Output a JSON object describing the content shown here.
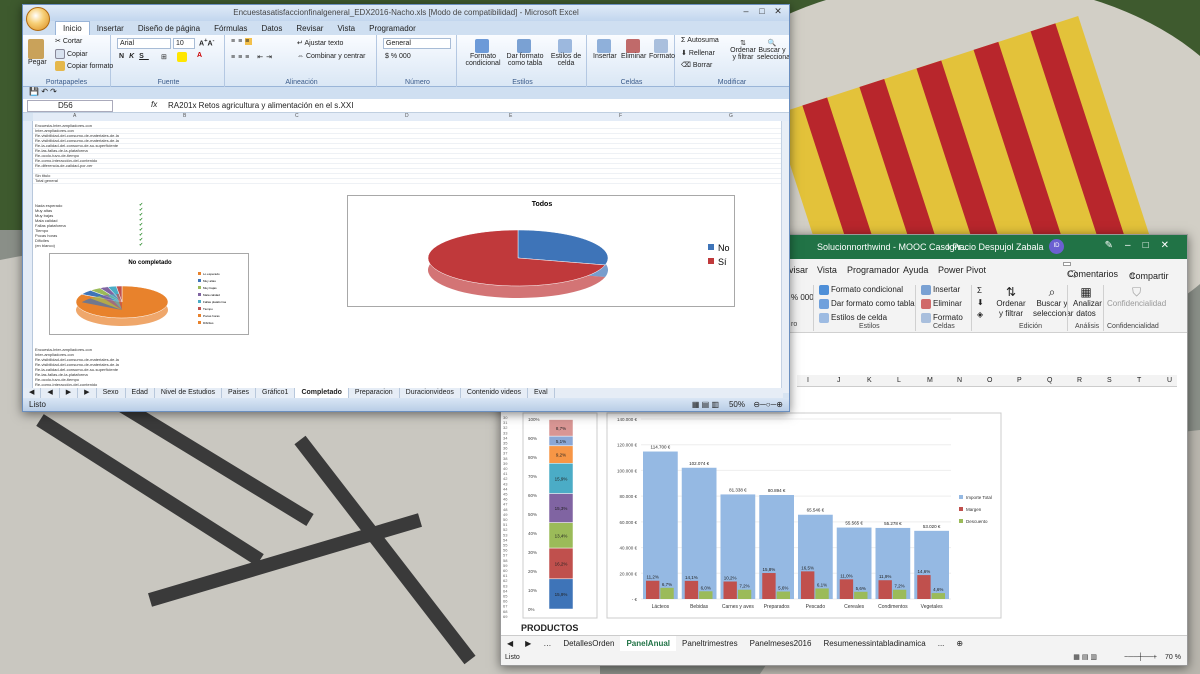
{
  "excel2007": {
    "title": "Encuestasatisfaccionfinalgeneral_EDX2016-Nacho.xls  [Modo de compatibilidad] - Microsoft Excel",
    "tabs": [
      "Inicio",
      "Insertar",
      "Diseño de página",
      "Fórmulas",
      "Datos",
      "Revisar",
      "Vista",
      "Programador"
    ],
    "clipboard": {
      "paste": "Pegar",
      "cut": "Cortar",
      "copy": "Copiar",
      "format_painter": "Copiar formato",
      "label": "Portapapeles"
    },
    "font": {
      "name": "Arial",
      "size": "10",
      "label": "Fuente"
    },
    "alignment": {
      "wrap": "Ajustar texto",
      "merge": "Combinar y centrar",
      "label": "Alineación"
    },
    "number": {
      "format": "General",
      "currency": "%",
      "thousands": "000",
      "label": "Número"
    },
    "styles": {
      "conditional": "Formato condicional",
      "as_table": "Dar formato como tabla",
      "cell_styles": "Estilos de celda",
      "label": "Estilos"
    },
    "cells": {
      "insert": "Insertar",
      "delete": "Eliminar",
      "format": "Formato",
      "label": "Celdas"
    },
    "editing": {
      "autosum": "Autosuma",
      "fill": "Rellenar",
      "clear": "Borrar",
      "sort": "Ordenar y filtrar",
      "find": "Buscar y seleccionar",
      "label": "Modificar"
    },
    "name_box": "D56",
    "formula": "RA201x Retos agricultura y alimentación en el s.XXI",
    "columns": [
      "A",
      "B",
      "C",
      "D",
      "E",
      "F",
      "G",
      "H"
    ],
    "sheet_rows": [
      "Encuesta-Inter-ampliadores-con",
      "Inter-ampliadores-con",
      "Re-visibilidad-del-consumo-de-materiales-de-la",
      "Re-visibilidad-del-consumo-de-materiales-de-la",
      "Re-la-calidad-del-consumo-de-su-superficiente",
      "Re-las-fallas-de-la-plataforma",
      "Re-ocolo-tuvo-de-tiempo",
      "Re-como-interacción-del-contenido",
      "Re-diferencia-de-calidad-por-ver",
      "",
      "Sin titulo",
      "Total general"
    ],
    "rating_rows": [
      "Nada esperado",
      "Muy altas",
      "Muy bajas",
      "Mala calidad",
      "Fallas plataforma",
      "Tiempo",
      "Pocas horas",
      "Difíciles",
      "(en blanco)"
    ],
    "sheet_tabs": [
      "Sexo",
      "Edad",
      "Nivel de Estudios",
      "Paises",
      "Gráfico1",
      "Completado",
      "Preparacion",
      "Duracionvideos",
      "Contenido videos",
      "Eval"
    ],
    "active_tab": "Completado",
    "status": "Listo",
    "zoom": "50%",
    "chart_todos": {
      "title": "Todos",
      "legend": [
        "No",
        "Sí"
      ],
      "slices": [
        {
          "label": "No",
          "value": 29,
          "color": "#3e74b8"
        },
        {
          "label": "Sí",
          "value": 71,
          "color": "#c0393b"
        }
      ]
    },
    "chart_no_completado": {
      "title": "No completado",
      "legend": [
        "Lo esperado",
        "Muy altas",
        "Muy bajas",
        "Mala calidad",
        "Fallas plataforma",
        "Tiempo",
        "Pocas horas",
        "Difíciles"
      ],
      "slices": [
        {
          "value": 83,
          "color": "#e8822c"
        },
        {
          "value": 5,
          "color": "#3e74b8"
        },
        {
          "value": 4,
          "color": "#9bbb59"
        },
        {
          "value": 3,
          "color": "#8064a2"
        },
        {
          "value": 3,
          "color": "#4bacc6"
        },
        {
          "value": 2,
          "color": "#c0504d"
        }
      ]
    }
  },
  "excel365": {
    "doc_title": "Solucionnorthwind - MOOC Caso Pr...",
    "user": "Ignacio Despujol Zabala",
    "user_initials": "ID",
    "tabs": [
      "visar",
      "Vista",
      "Programador",
      "Ayuda",
      "Power Pivot"
    ],
    "comments": "Comentarios",
    "share": "Compartir",
    "styles": {
      "conditional": "Formato condicional",
      "as_table": "Dar formato como tabla",
      "cell_styles": "Estilos de celda",
      "label": "Estilos"
    },
    "cells": {
      "insert": "Insertar",
      "delete": "Eliminar",
      "format": "Formato",
      "label": "Celdas"
    },
    "editing": {
      "sort": "Ordenar y filtrar",
      "find": "Buscar y seleccionar",
      "label": "Edición"
    },
    "analysis": {
      "analyze": "Analizar datos",
      "label": "Análisis"
    },
    "privacy": {
      "sensitivity": "Confidencialidad",
      "label": "Confidencialidad"
    },
    "partial_labels": {
      "number_pct": "% 000",
      "styles_tail": "ro"
    },
    "columns": [
      "I",
      "J",
      "K",
      "L",
      "M",
      "N",
      "O",
      "P",
      "Q",
      "R",
      "S",
      "T",
      "U"
    ],
    "section_label": "PRODUCTOS",
    "sheet_tabs": [
      "DetallesOrden",
      "PanelAnual",
      "Paneltrimestres",
      "Panelmeses2016",
      "Resumenessintabladinamica",
      "..."
    ],
    "active_tab": "PanelAnual",
    "status": "Listo",
    "zoom": "70 %"
  },
  "stack_chart": {
    "ticks": [
      "0%",
      "10%",
      "20%",
      "30%",
      "40%",
      "50%",
      "60%",
      "70%",
      "80%",
      "90%",
      "100%"
    ],
    "segments": [
      {
        "value": "15,9%",
        "v": 15.9,
        "color": "#3e74b8"
      },
      {
        "value": "16,2%",
        "v": 16.2,
        "color": "#c0504d"
      },
      {
        "value": "13,4%",
        "v": 13.4,
        "color": "#9bbb59"
      },
      {
        "value": "15,3%",
        "v": 15.3,
        "color": "#8064a2"
      },
      {
        "value": "15,9%",
        "v": 15.9,
        "color": "#4bacc6"
      },
      {
        "value": "9,2%",
        "v": 9.2,
        "color": "#f79646"
      },
      {
        "value": "5,1%",
        "v": 5.1,
        "color": "#8aa7d6"
      },
      {
        "value": "8,7%",
        "v": 8.7,
        "color": "#d99694"
      }
    ]
  },
  "chart_data": {
    "type": "bar",
    "categories": [
      "Lácteos",
      "Bebidas",
      "Carnes y aves",
      "Preparados",
      "Pescado",
      "Cereales",
      "Condimentos",
      "Vegetales"
    ],
    "series": [
      {
        "name": "Importe Total",
        "color": "#95b9e3",
        "values": [
          114700,
          102074,
          81338,
          80894,
          65546,
          55565,
          55278,
          53020
        ],
        "labels": [
          "114.700 €",
          "102.074 €",
          "81.338 €",
          "80.894 €",
          "65.546 €",
          "55.565 €",
          "55.278 €",
          "53.020 €"
        ]
      },
      {
        "name": "Margen",
        "color": "#c0504d",
        "values": [
          14200,
          14100,
          13600,
          20200,
          21500,
          15300,
          14600,
          18600
        ],
        "labels": [
          "11,2%",
          "14,1%",
          "10,2%",
          "15,8%",
          "16,5%",
          "11,0%",
          "11,9%",
          "14,6%"
        ]
      },
      {
        "name": "Descuento",
        "color": "#9bbb59",
        "values": [
          8700,
          6000,
          7200,
          5800,
          8200,
          5600,
          7200,
          4600
        ],
        "labels": [
          "6,7%",
          "6,0%",
          "7,2%",
          "5,6%",
          "6,1%",
          "5,6%",
          "7,2%",
          "4,6%"
        ]
      }
    ],
    "yticks": [
      "- €",
      "20.000 €",
      "40.000 €",
      "60.000 €",
      "80.000 €",
      "100.000 €",
      "120.000 €",
      "140.000 €"
    ],
    "ylim": [
      0,
      140000
    ]
  }
}
